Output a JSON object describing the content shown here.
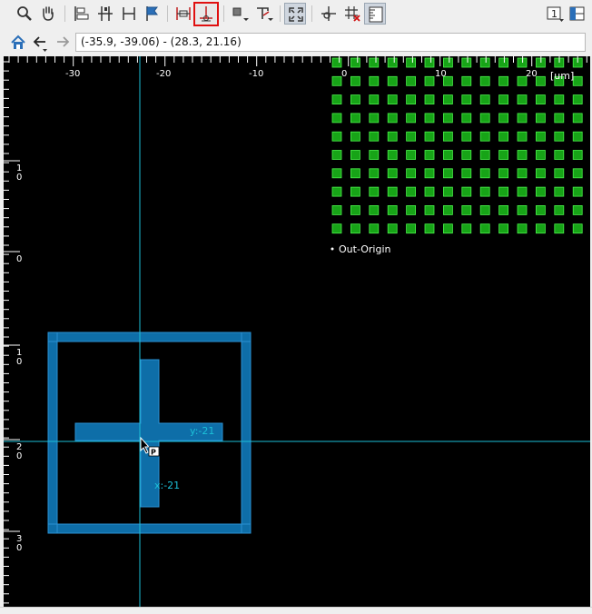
{
  "toolbar": {
    "buttons": [
      {
        "name": "zoom-tool-button",
        "icon": "magnifier-icon"
      },
      {
        "name": "pan-tool-button",
        "icon": "hand-icon"
      },
      {
        "name": "align-left-button",
        "icon": "align-left-icon"
      },
      {
        "name": "distribute-horizontal-button",
        "icon": "distribute-icon"
      },
      {
        "name": "align-width-button",
        "icon": "align-width-icon"
      },
      {
        "name": "flag-button",
        "icon": "flag-icon"
      },
      {
        "name": "snap-horizontal-button",
        "icon": "snap-horizontal-icon"
      },
      {
        "name": "snap-vertical-button",
        "icon": "snap-vertical-icon",
        "state": "active"
      },
      {
        "name": "shape-dropdown-button",
        "icon": "shape-icon"
      },
      {
        "name": "layer-dropdown-button",
        "icon": "layer-icon"
      },
      {
        "name": "zoom-fit-button",
        "icon": "zoom-fit-icon",
        "state": "pressed"
      },
      {
        "name": "origin-button",
        "icon": "origin-icon"
      },
      {
        "name": "grid-off-button",
        "icon": "grid-off-icon"
      },
      {
        "name": "ruler-button",
        "icon": "ruler-icon"
      },
      {
        "name": "page-number-button",
        "icon": "page-icon",
        "label": "1"
      },
      {
        "name": "panel-layout-button",
        "icon": "panel-icon"
      }
    ]
  },
  "navbar": {
    "coordinates": "(-35.9, -39.06) - (28.3, 21.16)"
  },
  "canvas": {
    "unit_label": "[um]",
    "x_ticks": [
      "-30",
      "-20",
      "-10",
      "0",
      "10",
      "20"
    ],
    "y_ticks": [
      {
        "line1": "1",
        "line2": "0"
      },
      {
        "line1": "0",
        "line2": ""
      },
      {
        "line1": "1",
        "line2": "0"
      },
      {
        "line1": "2",
        "line2": "0"
      },
      {
        "line1": "3",
        "line2": "0"
      }
    ],
    "origin_label": "Out-Origin",
    "y_readout": "y:-21",
    "x_readout": "x:-21",
    "cursor_badge": "P",
    "colors": {
      "background": "#000000",
      "pad_fill": "#17a417",
      "pad_stroke": "#4cf24c",
      "shape_fill": "#0e6ea8",
      "shape_stroke": "#2a90d2",
      "crosshair": "#1cc0d8",
      "ruler": "#ffffff"
    },
    "pad_grid": {
      "rows": 10,
      "cols": 14
    }
  }
}
